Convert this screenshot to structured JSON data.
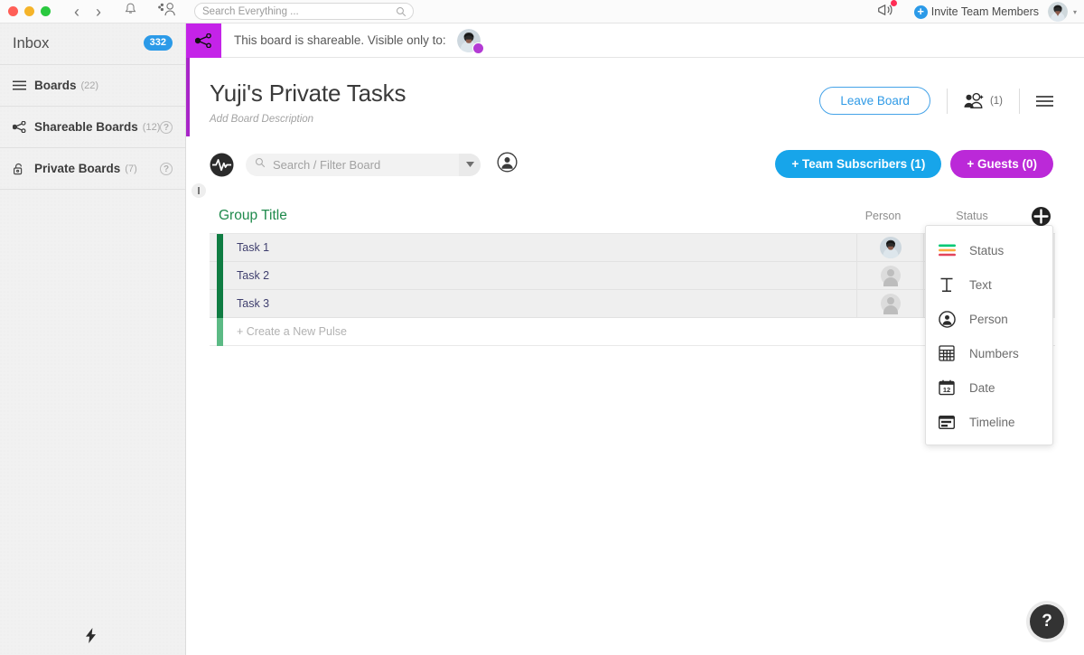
{
  "window": {
    "nav": {
      "back": "‹",
      "forward": "›"
    },
    "icons": [
      "bell-icon",
      "people-icon",
      "megaphone-icon"
    ],
    "search": {
      "placeholder": "Search Everything ...",
      "value": ""
    }
  },
  "top_right": {
    "invite_label": "Invite Team Members",
    "notification_dot_color": "#ff2d55",
    "caret": "▾"
  },
  "sidebar": {
    "inbox": {
      "label": "Inbox",
      "badge": "332"
    },
    "items": [
      {
        "label": "Boards",
        "count": "(22)",
        "icon": "list-icon",
        "help": false
      },
      {
        "label": "Shareable Boards",
        "count": "(12)",
        "icon": "share-icon",
        "help": true,
        "help_glyph": "?"
      },
      {
        "label": "Private Boards",
        "count": "(7)",
        "icon": "lock-icon",
        "help": true,
        "help_glyph": "?"
      }
    ],
    "bottom_icon": "lightning-icon",
    "accent_color": "#a825c8"
  },
  "banner": {
    "icon": "share-icon",
    "icon_bg": "#c423e8",
    "text": "This board is shareable. Visible only to:",
    "avatar": "user-avatar"
  },
  "board": {
    "title": "Yuji's Private Tasks",
    "description_placeholder": "Add Board Description",
    "leave_label": "Leave Board",
    "subscriber_count": "(1)",
    "menu_icon": "hamburger-icon"
  },
  "filter": {
    "pulse_icon": "pulse-icon",
    "search_placeholder": "Search / Filter Board",
    "search_value": "",
    "dropdown_caret": "▾",
    "person_icon": "person-filter-icon",
    "buttons": [
      {
        "label": "+ Team Subscribers (1)",
        "color": "#17a5ea"
      },
      {
        "label": "+ Guests (0)",
        "color": "#bb29d8"
      }
    ]
  },
  "table": {
    "group_title": "Group Title",
    "group_color": "#1f8a4c",
    "columns": [
      "Person",
      "Status"
    ],
    "add_column_icon": "plus-circle-icon",
    "rows": [
      {
        "name": "Task 1",
        "person": "avatar-photo",
        "status_color": "#fdab3d"
      },
      {
        "name": "Task 2",
        "person": "avatar-placeholder",
        "status_color": "#00c875"
      },
      {
        "name": "Task 3",
        "person": "avatar-placeholder",
        "status_color": "#c4c4c4"
      }
    ],
    "new_pulse_label": "+ Create a New Pulse"
  },
  "column_menu": {
    "items": [
      {
        "label": "Status",
        "icon": "status-bars-icon"
      },
      {
        "label": "Text",
        "icon": "text-t-icon"
      },
      {
        "label": "Person",
        "icon": "person-circle-icon"
      },
      {
        "label": "Numbers",
        "icon": "numbers-grid-icon"
      },
      {
        "label": "Date",
        "icon": "calendar-icon"
      },
      {
        "label": "Timeline",
        "icon": "timeline-icon"
      }
    ]
  },
  "help": {
    "glyph": "?"
  }
}
